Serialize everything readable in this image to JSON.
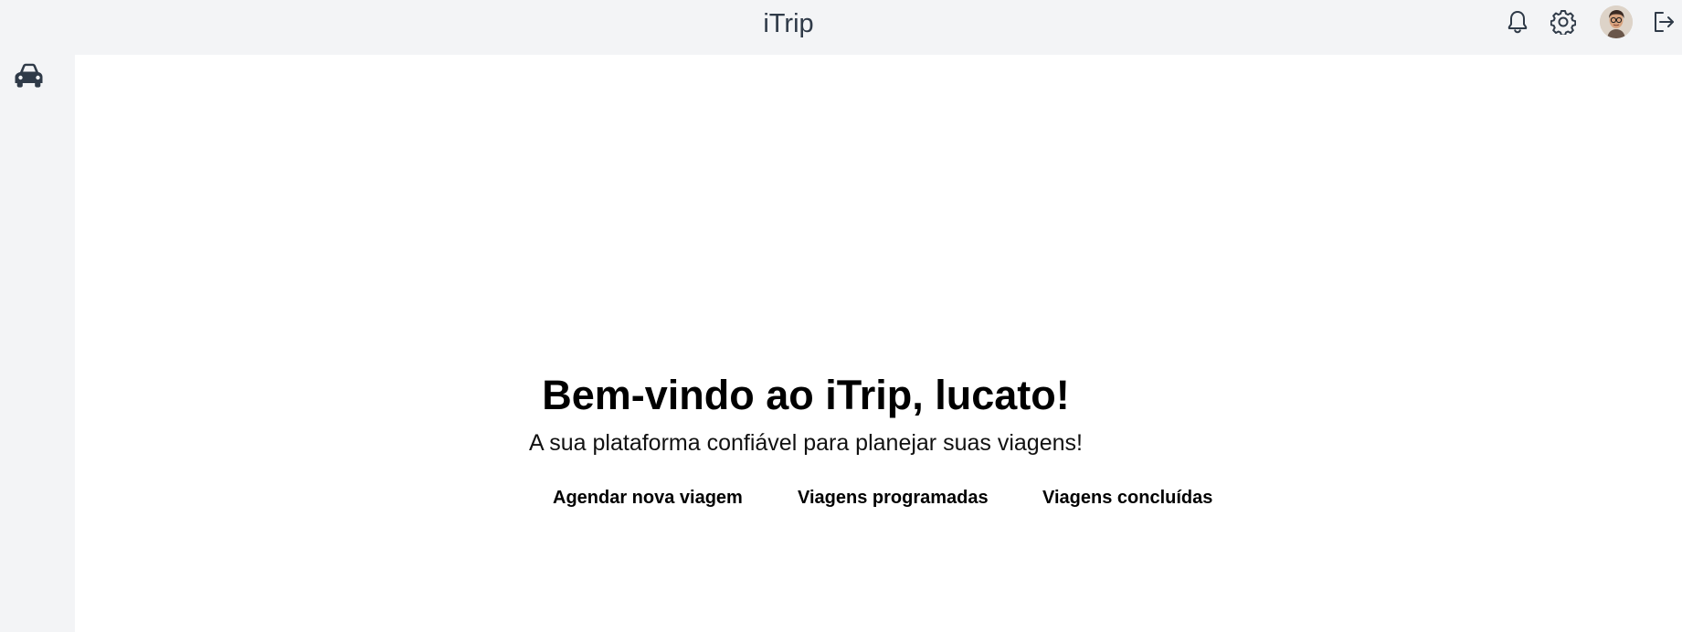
{
  "header": {
    "title": "iTrip",
    "icons": {
      "notifications": "bell-icon",
      "settings": "gear-icon",
      "profile": "avatar",
      "logout": "logout-icon"
    }
  },
  "sidebar": {
    "items": [
      {
        "icon": "car-icon"
      }
    ]
  },
  "main": {
    "welcome": "Bem-vindo ao iTrip, lucato!",
    "subtitle": "A sua plataforma confiável para planejar suas viagens!",
    "actions": [
      {
        "label": "Agendar nova viagem"
      },
      {
        "label": "Viagens programadas"
      },
      {
        "label": "Viagens concluídas"
      }
    ]
  },
  "colors": {
    "background": "#f3f4f6",
    "content": "#ffffff",
    "iconColor": "#2f3a48"
  }
}
